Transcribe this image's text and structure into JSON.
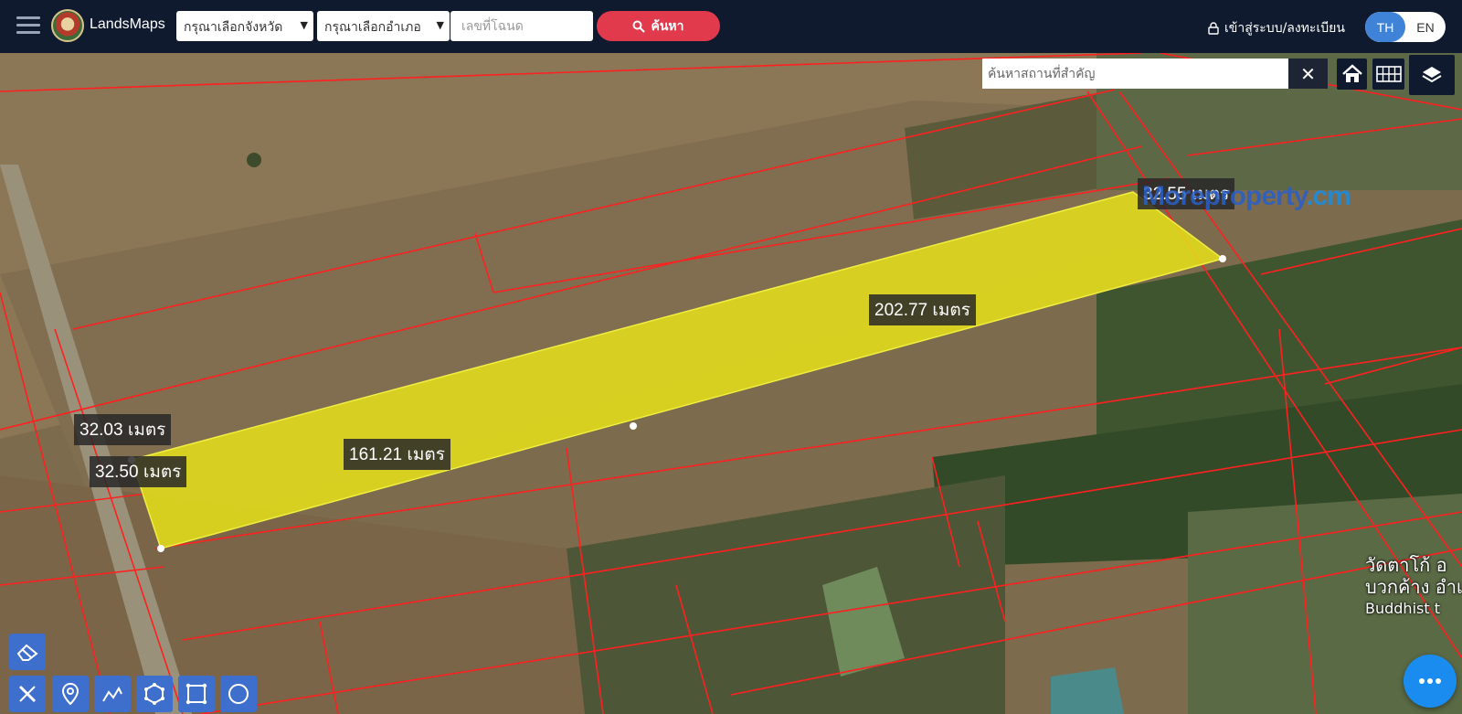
{
  "header": {
    "brand": "LandsMaps",
    "province_select": "กรุณาเลือกจังหวัด",
    "district_select": "กรุณาเลือกอำเภอ",
    "deed_placeholder": "เลขที่โฉนด",
    "search_label": "ค้นหา",
    "login_label": "เข้าสู่ระบบ/ลงทะเบียน",
    "lang_th": "TH",
    "lang_en": "EN"
  },
  "map": {
    "place_search_placeholder": "ค้นหาสถานที่สำคัญ",
    "clear_label": "✕",
    "measurements": [
      "32.55 เมตร",
      "202.77 เมตร",
      "32.03 เมตร",
      "161.21 เมตร",
      "32.50 เมตร"
    ],
    "watermark_main": "Moreproperty",
    "watermark_suffix": ".cm",
    "temple_line1": "วัดตาโก้ อ",
    "temple_line2": "บวกค้าง อำเ",
    "temple_line3": "Buddhist t",
    "plot_color": "#e6e21a",
    "boundary_color": "#ff2020"
  },
  "tools": [
    "eraser-icon",
    "ruler-icon",
    "location-pin-icon",
    "polyline-icon",
    "polygon-icon",
    "rectangle-icon",
    "circle-icon"
  ]
}
